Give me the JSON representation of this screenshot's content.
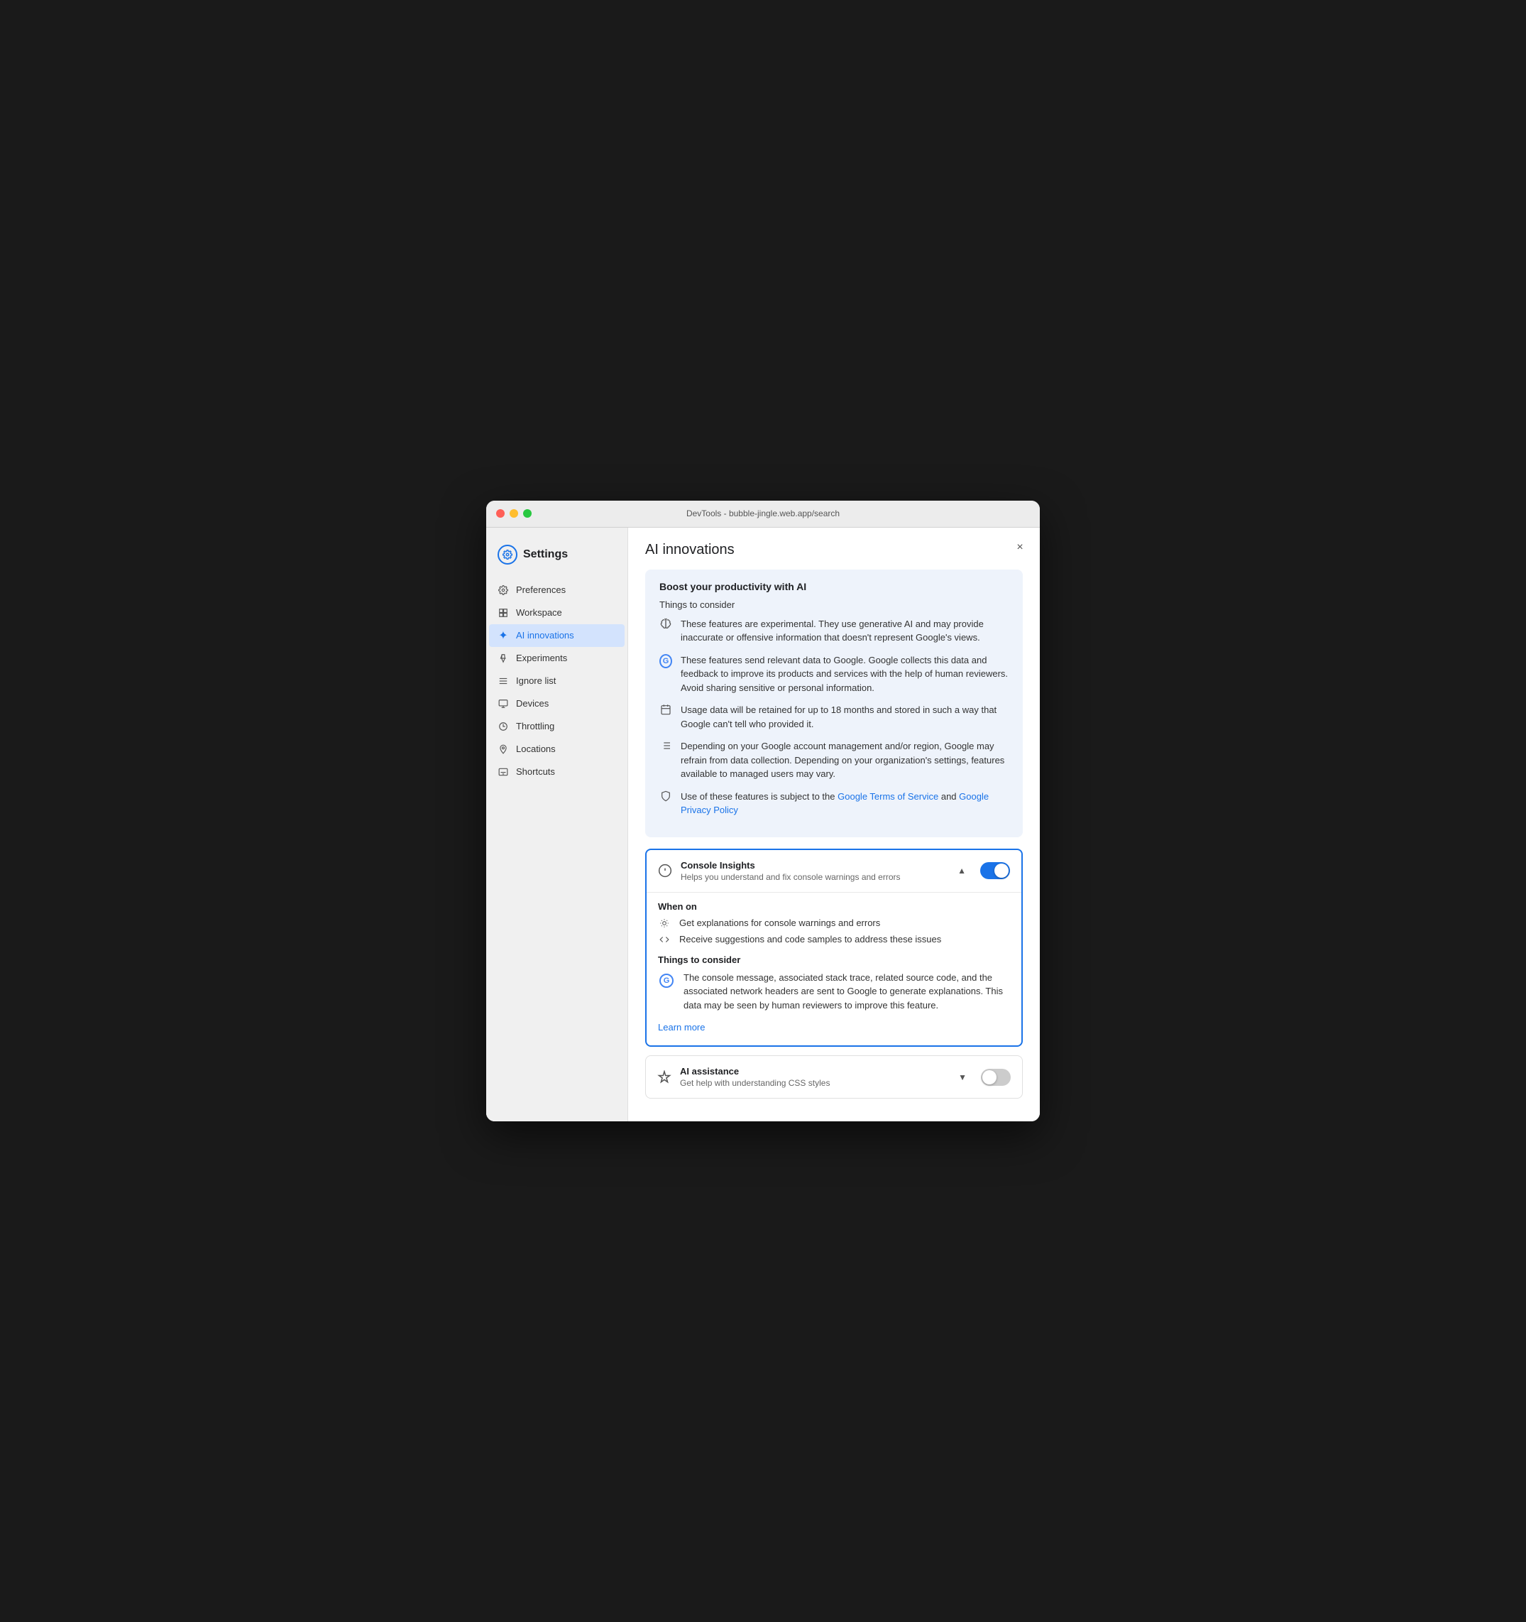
{
  "window": {
    "title": "DevTools - bubble-jingle.web.app/search"
  },
  "sidebar": {
    "header": {
      "title": "Settings"
    },
    "items": [
      {
        "id": "preferences",
        "label": "Preferences",
        "icon": "⚙"
      },
      {
        "id": "workspace",
        "label": "Workspace",
        "icon": "📁"
      },
      {
        "id": "ai-innovations",
        "label": "AI innovations",
        "icon": "✦",
        "active": true
      },
      {
        "id": "experiments",
        "label": "Experiments",
        "icon": "⚗"
      },
      {
        "id": "ignore-list",
        "label": "Ignore list",
        "icon": "≡"
      },
      {
        "id": "devices",
        "label": "Devices",
        "icon": "⬜"
      },
      {
        "id": "throttling",
        "label": "Throttling",
        "icon": "◷"
      },
      {
        "id": "locations",
        "label": "Locations",
        "icon": "📍"
      },
      {
        "id": "shortcuts",
        "label": "Shortcuts",
        "icon": "⌨"
      }
    ]
  },
  "main": {
    "title": "AI innovations",
    "close_button": "×",
    "info_card": {
      "title": "Boost your productivity with AI",
      "subtitle": "Things to consider",
      "items": [
        {
          "icon": "brain",
          "text": "These features are experimental. They use generative AI and may provide inaccurate or offensive information that doesn't represent Google's views."
        },
        {
          "icon": "google",
          "text": "These features send relevant data to Google. Google collects this data and feedback to improve its products and services with the help of human reviewers. Avoid sharing sensitive or personal information."
        },
        {
          "icon": "calendar",
          "text": "Usage data will be retained for up to 18 months and stored in such a way that Google can't tell who provided it."
        },
        {
          "icon": "list",
          "text": "Depending on your Google account management and/or region, Google may refrain from data collection. Depending on your organization's settings, features available to managed users may vary."
        },
        {
          "icon": "shield",
          "text_before": "Use of these features is subject to the ",
          "link1_text": "Google Terms of Service",
          "link1_url": "#",
          "text_middle": " and ",
          "link2_text": "Google Privacy Policy",
          "link2_url": "#"
        }
      ]
    },
    "console_insights": {
      "name": "Console Insights",
      "description": "Helps you understand and fix console warnings and errors",
      "enabled": true,
      "expanded": true,
      "when_on_title": "When on",
      "when_on_items": [
        {
          "icon": "bulb",
          "text": "Get explanations for console warnings and errors"
        },
        {
          "icon": "code",
          "text": "Receive suggestions and code samples to address these issues"
        }
      ],
      "things_title": "Things to consider",
      "things_items": [
        {
          "icon": "google",
          "text": "The console message, associated stack trace, related source code, and the associated network headers are sent to Google to generate explanations. This data may be seen by human reviewers to improve this feature."
        }
      ],
      "learn_more_text": "Learn more",
      "learn_more_url": "#"
    },
    "ai_assistance": {
      "name": "AI assistance",
      "description": "Get help with understanding CSS styles",
      "enabled": false,
      "expanded": false
    }
  }
}
